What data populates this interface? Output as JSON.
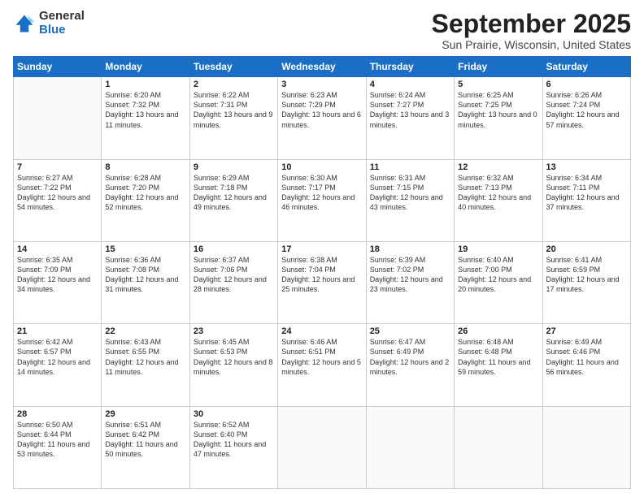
{
  "logo": {
    "general": "General",
    "blue": "Blue"
  },
  "header": {
    "month": "September 2025",
    "location": "Sun Prairie, Wisconsin, United States"
  },
  "weekdays": [
    "Sunday",
    "Monday",
    "Tuesday",
    "Wednesday",
    "Thursday",
    "Friday",
    "Saturday"
  ],
  "weeks": [
    [
      {
        "day": "",
        "sunrise": "",
        "sunset": "",
        "daylight": ""
      },
      {
        "day": "1",
        "sunrise": "6:20 AM",
        "sunset": "7:32 PM",
        "daylight": "13 hours and 11 minutes."
      },
      {
        "day": "2",
        "sunrise": "6:22 AM",
        "sunset": "7:31 PM",
        "daylight": "13 hours and 9 minutes."
      },
      {
        "day": "3",
        "sunrise": "6:23 AM",
        "sunset": "7:29 PM",
        "daylight": "13 hours and 6 minutes."
      },
      {
        "day": "4",
        "sunrise": "6:24 AM",
        "sunset": "7:27 PM",
        "daylight": "13 hours and 3 minutes."
      },
      {
        "day": "5",
        "sunrise": "6:25 AM",
        "sunset": "7:25 PM",
        "daylight": "13 hours and 0 minutes."
      },
      {
        "day": "6",
        "sunrise": "6:26 AM",
        "sunset": "7:24 PM",
        "daylight": "12 hours and 57 minutes."
      }
    ],
    [
      {
        "day": "7",
        "sunrise": "6:27 AM",
        "sunset": "7:22 PM",
        "daylight": "12 hours and 54 minutes."
      },
      {
        "day": "8",
        "sunrise": "6:28 AM",
        "sunset": "7:20 PM",
        "daylight": "12 hours and 52 minutes."
      },
      {
        "day": "9",
        "sunrise": "6:29 AM",
        "sunset": "7:18 PM",
        "daylight": "12 hours and 49 minutes."
      },
      {
        "day": "10",
        "sunrise": "6:30 AM",
        "sunset": "7:17 PM",
        "daylight": "12 hours and 46 minutes."
      },
      {
        "day": "11",
        "sunrise": "6:31 AM",
        "sunset": "7:15 PM",
        "daylight": "12 hours and 43 minutes."
      },
      {
        "day": "12",
        "sunrise": "6:32 AM",
        "sunset": "7:13 PM",
        "daylight": "12 hours and 40 minutes."
      },
      {
        "day": "13",
        "sunrise": "6:34 AM",
        "sunset": "7:11 PM",
        "daylight": "12 hours and 37 minutes."
      }
    ],
    [
      {
        "day": "14",
        "sunrise": "6:35 AM",
        "sunset": "7:09 PM",
        "daylight": "12 hours and 34 minutes."
      },
      {
        "day": "15",
        "sunrise": "6:36 AM",
        "sunset": "7:08 PM",
        "daylight": "12 hours and 31 minutes."
      },
      {
        "day": "16",
        "sunrise": "6:37 AM",
        "sunset": "7:06 PM",
        "daylight": "12 hours and 28 minutes."
      },
      {
        "day": "17",
        "sunrise": "6:38 AM",
        "sunset": "7:04 PM",
        "daylight": "12 hours and 25 minutes."
      },
      {
        "day": "18",
        "sunrise": "6:39 AM",
        "sunset": "7:02 PM",
        "daylight": "12 hours and 23 minutes."
      },
      {
        "day": "19",
        "sunrise": "6:40 AM",
        "sunset": "7:00 PM",
        "daylight": "12 hours and 20 minutes."
      },
      {
        "day": "20",
        "sunrise": "6:41 AM",
        "sunset": "6:59 PM",
        "daylight": "12 hours and 17 minutes."
      }
    ],
    [
      {
        "day": "21",
        "sunrise": "6:42 AM",
        "sunset": "6:57 PM",
        "daylight": "12 hours and 14 minutes."
      },
      {
        "day": "22",
        "sunrise": "6:43 AM",
        "sunset": "6:55 PM",
        "daylight": "12 hours and 11 minutes."
      },
      {
        "day": "23",
        "sunrise": "6:45 AM",
        "sunset": "6:53 PM",
        "daylight": "12 hours and 8 minutes."
      },
      {
        "day": "24",
        "sunrise": "6:46 AM",
        "sunset": "6:51 PM",
        "daylight": "12 hours and 5 minutes."
      },
      {
        "day": "25",
        "sunrise": "6:47 AM",
        "sunset": "6:49 PM",
        "daylight": "12 hours and 2 minutes."
      },
      {
        "day": "26",
        "sunrise": "6:48 AM",
        "sunset": "6:48 PM",
        "daylight": "11 hours and 59 minutes."
      },
      {
        "day": "27",
        "sunrise": "6:49 AM",
        "sunset": "6:46 PM",
        "daylight": "11 hours and 56 minutes."
      }
    ],
    [
      {
        "day": "28",
        "sunrise": "6:50 AM",
        "sunset": "6:44 PM",
        "daylight": "11 hours and 53 minutes."
      },
      {
        "day": "29",
        "sunrise": "6:51 AM",
        "sunset": "6:42 PM",
        "daylight": "11 hours and 50 minutes."
      },
      {
        "day": "30",
        "sunrise": "6:52 AM",
        "sunset": "6:40 PM",
        "daylight": "11 hours and 47 minutes."
      },
      {
        "day": "",
        "sunrise": "",
        "sunset": "",
        "daylight": ""
      },
      {
        "day": "",
        "sunrise": "",
        "sunset": "",
        "daylight": ""
      },
      {
        "day": "",
        "sunrise": "",
        "sunset": "",
        "daylight": ""
      },
      {
        "day": "",
        "sunrise": "",
        "sunset": "",
        "daylight": ""
      }
    ]
  ],
  "labels": {
    "sunrise_prefix": "Sunrise: ",
    "sunset_prefix": "Sunset: ",
    "daylight_prefix": "Daylight: "
  }
}
